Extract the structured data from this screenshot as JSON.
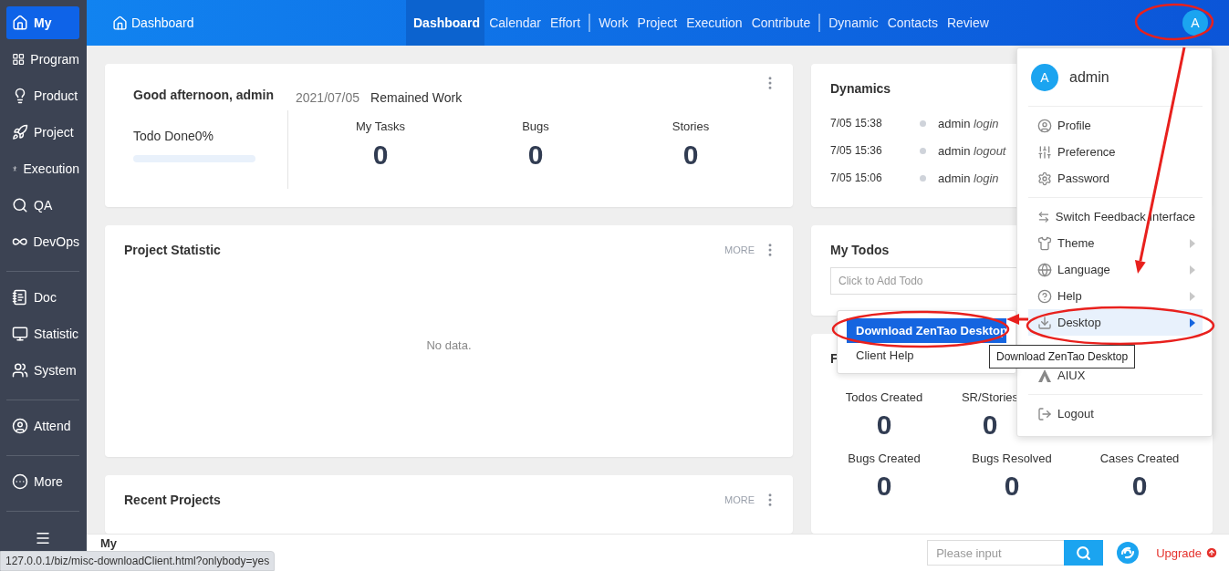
{
  "sidebar": {
    "groups": [
      {
        "items": [
          {
            "label": "My",
            "selected": true
          },
          {
            "label": "Program",
            "selected": false
          },
          {
            "label": "Product",
            "selected": false
          },
          {
            "label": "Project",
            "selected": false
          },
          {
            "label": "Execution",
            "selected": false
          },
          {
            "label": "QA",
            "selected": false
          },
          {
            "label": "DevOps",
            "selected": false
          }
        ]
      },
      {
        "items": [
          {
            "label": "Doc",
            "selected": false
          },
          {
            "label": "Statistic",
            "selected": false
          },
          {
            "label": "System",
            "selected": false
          }
        ]
      },
      {
        "items": [
          {
            "label": "Attend",
            "selected": false
          }
        ]
      },
      {
        "items": [
          {
            "label": "More",
            "selected": false
          }
        ]
      }
    ]
  },
  "header": {
    "title": "Dashboard",
    "avatar": "A",
    "nav_groups": [
      {
        "items": [
          {
            "label": "Dashboard",
            "selected": true
          },
          {
            "label": "Calendar",
            "selected": false
          },
          {
            "label": "Effort",
            "selected": false
          }
        ]
      },
      {
        "items": [
          {
            "label": "Work",
            "selected": false
          },
          {
            "label": "Project",
            "selected": false
          },
          {
            "label": "Execution",
            "selected": false
          },
          {
            "label": "Contribute",
            "selected": false
          }
        ]
      },
      {
        "items": [
          {
            "label": "Dynamic",
            "selected": false
          },
          {
            "label": "Contacts",
            "selected": false
          },
          {
            "label": "Review",
            "selected": false
          }
        ]
      }
    ]
  },
  "welcome_card": {
    "greeting": "Good afternoon, admin",
    "date": "2021/07/05",
    "subtitle": "Remained Work",
    "todo_label": "Todo Done0%",
    "level": 0,
    "stats": [
      {
        "label": "My Tasks",
        "value": "0"
      },
      {
        "label": "Bugs",
        "value": "0"
      },
      {
        "label": "Stories",
        "value": "0"
      }
    ]
  },
  "project_statistic": {
    "title": "Project Statistic",
    "more": "MORE",
    "empty": "No data."
  },
  "recent_projects": {
    "title": "Recent Projects",
    "more": "MORE"
  },
  "dynamics": {
    "title": "Dynamics",
    "entries": [
      {
        "time": "7/05 15:38",
        "user": "admin",
        "action": "login"
      },
      {
        "time": "7/05 15:36",
        "user": "admin",
        "action": "logout"
      },
      {
        "time": "7/05 15:06",
        "user": "admin",
        "action": "login"
      }
    ]
  },
  "todos": {
    "title": "My Todos",
    "placeholder": "Click to Add Todo"
  },
  "stats_card": {
    "title": "F",
    "stat_rows": [
      {
        "items": [
          {
            "label": "Todos Created",
            "value": "0"
          },
          {
            "label": "SR/Stories",
            "value": "0"
          }
        ]
      },
      {
        "items": [
          {
            "label": "Bugs Created",
            "value": "0"
          },
          {
            "label": "Bugs Resolved",
            "value": "0"
          },
          {
            "label": "Cases Created",
            "value": "0"
          }
        ]
      }
    ]
  },
  "user_menu": {
    "avatar": "A",
    "name": "admin",
    "groups": [
      {
        "items": [
          {
            "label": "Profile",
            "kind": "plain",
            "selected": false
          },
          {
            "label": "Preference",
            "kind": "plain",
            "selected": false
          },
          {
            "label": "Password",
            "kind": "plain",
            "selected": false
          }
        ]
      },
      {
        "items": [
          {
            "label": "Switch Feedback Interface",
            "kind": "plain",
            "selected": false
          },
          {
            "label": "Theme",
            "kind": "submenu",
            "selected": false
          },
          {
            "label": "Language",
            "kind": "submenu",
            "selected": false
          },
          {
            "label": "Help",
            "kind": "submenu",
            "selected": false
          },
          {
            "label": "Desktop",
            "kind": "submenu",
            "selected": true
          },
          {
            "label": "AIUX",
            "kind": "plain",
            "selected": false
          }
        ]
      },
      {
        "items": [
          {
            "label": "Logout",
            "kind": "plain",
            "selected": false
          }
        ]
      }
    ]
  },
  "desktop_submenu": {
    "items": [
      {
        "label": "Download ZenTao Desktop",
        "selected": true
      },
      {
        "label": "Client Help",
        "selected": false
      }
    ]
  },
  "tooltip": "Download ZenTao Desktop",
  "footer": {
    "breadcrumb": "My",
    "search_placeholder": "Please input",
    "upgrade": "Upgrade"
  },
  "status_url": "127.0.0.1/biz/misc-downloadClient.html?onlybody=yes",
  "annotations": [
    {
      "kind": "ellipse"
    },
    {
      "kind": "ellipse"
    },
    {
      "kind": "ellipse"
    },
    {
      "kind": "arrow"
    },
    {
      "kind": "arrow"
    }
  ]
}
